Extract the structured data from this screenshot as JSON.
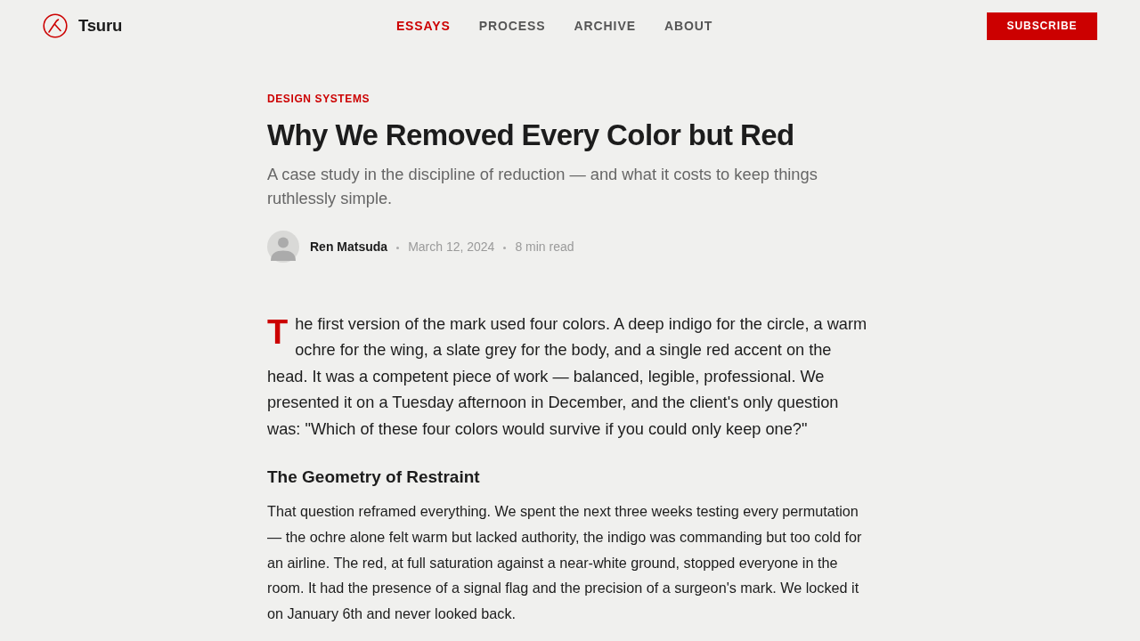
{
  "header": {
    "brand": "Tsuru",
    "nav": [
      {
        "label": "ESSAYS",
        "selected": true
      },
      {
        "label": "PROCESS",
        "selected": false
      },
      {
        "label": "ARCHIVE",
        "selected": false
      },
      {
        "label": "ABOUT",
        "selected": false
      }
    ],
    "subscribe_button": "SUBSCRIBE"
  },
  "article": {
    "category": "DESIGN SYSTEMS",
    "title": "Why We Removed Every Color but Red",
    "subtitle": "A case study in the discipline of reduction — and what it costs to keep things ruthlessly simple.",
    "byline": {
      "author": "Ren Matsuda",
      "date": "March 12, 2024",
      "read_time": "8 min read"
    },
    "body": [
      {
        "kind": "lead",
        "drop_cap": true,
        "text": "The first version of the mark used four colors. A deep indigo for the circle, a warm ochre for the wing, a slate grey for the body, and a single red accent on the head. It was a competent piece of work — balanced, legible, professional. We presented it on a Tuesday afternoon in December, and the client's only question was: \"Which of these four colors would survive if you could only keep one?\""
      },
      {
        "kind": "heading",
        "text": "The Geometry of Restraint"
      },
      {
        "kind": "paragraph",
        "drop_cap": false,
        "text": "That question reframed everything. We spent the next three weeks testing every permutation — the ochre alone felt warm but lacked authority, the indigo was commanding but too cold for an airline. The red, at full saturation against a near-white ground, stopped everyone in the room. It had the presence of a signal flag and the precision of a surgeon's mark. We locked it on January 6th and never looked back."
      }
    ]
  }
}
